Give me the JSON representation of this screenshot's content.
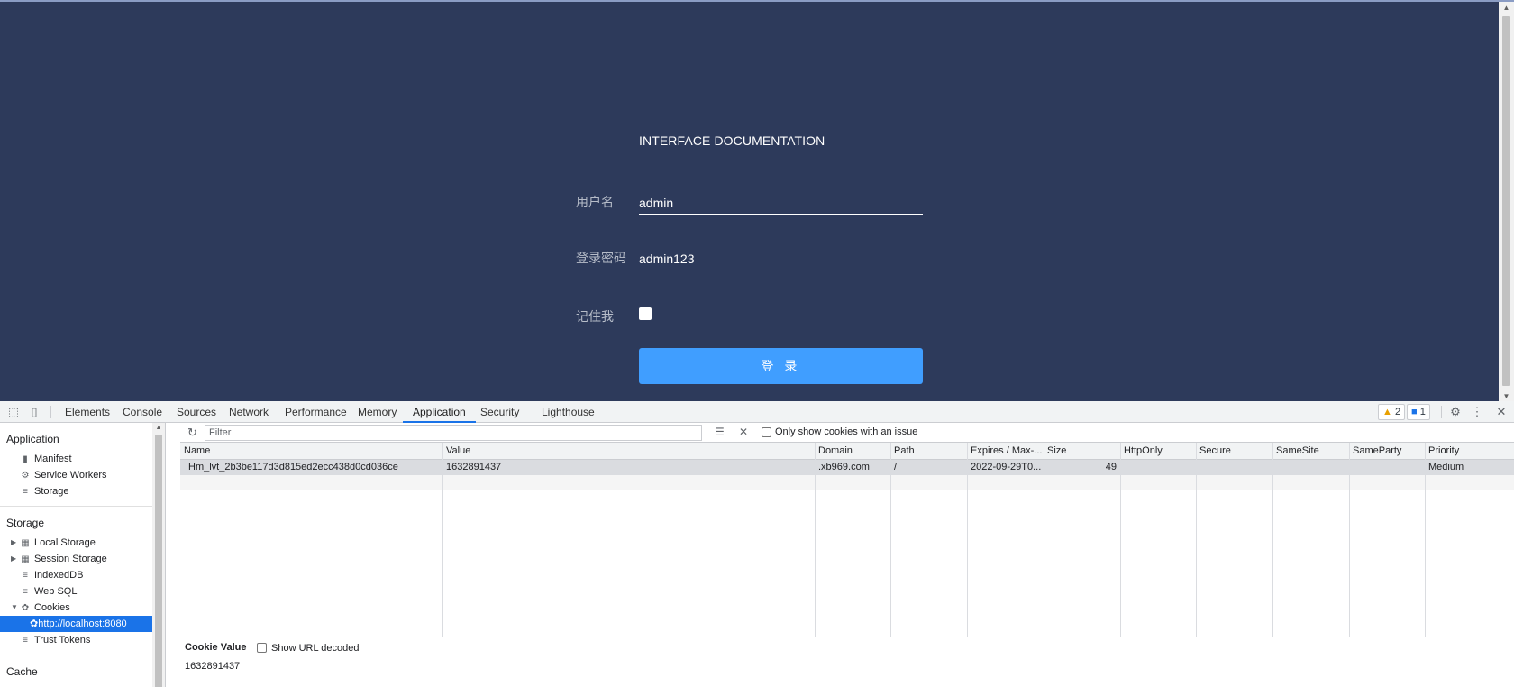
{
  "login": {
    "title": "INTERFACE DOCUMENTATION",
    "username_label": "用户名",
    "username_value": "admin",
    "password_label": "登录密码",
    "password_value": "admin123",
    "remember_label": "记住我",
    "submit_label": "登 录"
  },
  "devtools": {
    "tabs": [
      "Elements",
      "Console",
      "Sources",
      "Network",
      "Performance",
      "Memory",
      "Application",
      "Security",
      "Lighthouse"
    ],
    "active_tab": "Application",
    "warning_count": "2",
    "message_count": "1",
    "sidebar": {
      "application_header": "Application",
      "application_items": [
        {
          "label": "Manifest",
          "icon": "file-icon"
        },
        {
          "label": "Service Workers",
          "icon": "gear-icon"
        },
        {
          "label": "Storage",
          "icon": "database-icon"
        }
      ],
      "storage_header": "Storage",
      "storage_items": [
        {
          "label": "Local Storage",
          "icon": "grid-icon"
        },
        {
          "label": "Session Storage",
          "icon": "grid-icon"
        },
        {
          "label": "IndexedDB",
          "icon": "database-icon"
        },
        {
          "label": "Web SQL",
          "icon": "database-icon"
        },
        {
          "label": "Cookies",
          "icon": "cookie-icon"
        }
      ],
      "cookie_origin": "http://localhost:8080",
      "trust_tokens": "Trust Tokens",
      "cache_header": "Cache"
    },
    "toolbar": {
      "filter_placeholder": "Filter",
      "only_issues_label": "Only show cookies with an issue"
    },
    "table": {
      "columns": [
        "Name",
        "Value",
        "Domain",
        "Path",
        "Expires / Max-...",
        "Size",
        "HttpOnly",
        "Secure",
        "SameSite",
        "SameParty",
        "Priority"
      ],
      "rows": [
        {
          "name": "Hm_lvt_2b3be117d3d815ed2ecc438d0cd036ce",
          "value": "1632891437",
          "domain": ".xb969.com",
          "path": "/",
          "expires": "2022-09-29T0...",
          "size": "49",
          "httponly": "",
          "secure": "",
          "samesite": "",
          "sameparty": "",
          "priority": "Medium"
        }
      ]
    },
    "cookie_value_panel": {
      "title": "Cookie Value",
      "decode_label": "Show URL decoded",
      "value": "1632891437"
    }
  }
}
